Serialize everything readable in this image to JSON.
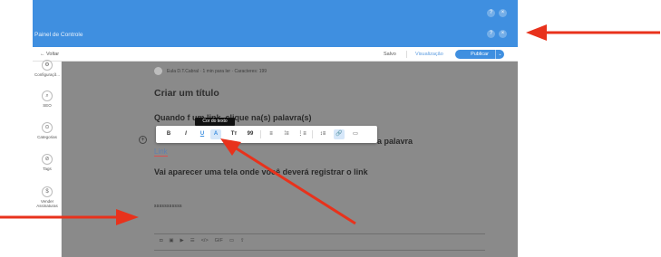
{
  "header": {
    "title": "Painel de Controle",
    "help_glyph": "?",
    "close_glyph": "×"
  },
  "subbar": {
    "back_label": "← Voltar",
    "saved_label": "Salvo",
    "preview_label": "Visualização",
    "publish_label": "Publicar",
    "publish_dropdown_glyph": "⌄"
  },
  "sidebar": {
    "items": [
      {
        "label": "Configuraçõ...",
        "icon": "gear-icon",
        "glyph": "⚙"
      },
      {
        "label": "SEO",
        "icon": "search-icon",
        "glyph": "⌕"
      },
      {
        "label": "Categorias",
        "icon": "category-icon",
        "glyph": "⊙"
      },
      {
        "label": "Tags",
        "icon": "tag-icon",
        "glyph": "⊘"
      },
      {
        "label": "Vender Assinaturas",
        "icon": "dollar-icon",
        "glyph": "$"
      }
    ]
  },
  "post": {
    "author_line": "Eula D.T.Cabral · 1 min para ler · Caracteres: 199",
    "title": "Criar um título",
    "paragraph1": "Quando f          um link, clique na(s) palavra(s)",
    "paragraph2_end": "a palavra",
    "link_word": "Link",
    "paragraph3": "Vai aparecer uma tela onde você deverá registrar o link",
    "placeholder": "sssssssssss",
    "plus_glyph": "+"
  },
  "format_toolbar": {
    "tooltip": "Cor do texto",
    "buttons": [
      {
        "name": "bold-button",
        "glyph": "B"
      },
      {
        "name": "italic-button",
        "glyph": "I"
      },
      {
        "name": "underline-button",
        "glyph": "U"
      },
      {
        "name": "text-color-button",
        "glyph": "A"
      },
      {
        "name": "text-size-button",
        "glyph": "Tт"
      },
      {
        "name": "quote-button",
        "glyph": "99"
      },
      {
        "name": "align-left-button",
        "glyph": "≡"
      },
      {
        "name": "numbered-list-button",
        "glyph": "⁞≡"
      },
      {
        "name": "bullet-list-button",
        "glyph": "⋮≡"
      },
      {
        "name": "line-spacing-button",
        "glyph": "↕≡"
      },
      {
        "name": "link-button",
        "glyph": "🔗"
      },
      {
        "name": "embed-button",
        "glyph": "▭"
      }
    ]
  },
  "insert_bar": {
    "items": [
      {
        "name": "camera-icon",
        "glyph": "◘"
      },
      {
        "name": "gallery-icon",
        "glyph": "▣"
      },
      {
        "name": "video-icon",
        "glyph": "▶"
      },
      {
        "name": "divider-icon",
        "glyph": "☰"
      },
      {
        "name": "code-icon",
        "glyph": "</>"
      },
      {
        "name": "gif-icon",
        "glyph": "GIF"
      },
      {
        "name": "embed-icon",
        "glyph": "▭"
      },
      {
        "name": "upload-icon",
        "glyph": "⇪"
      }
    ]
  },
  "colors": {
    "brand_blue": "#3f8fe0",
    "overlay_gray": "#8a8a8a",
    "annotation_red": "#e8321c"
  }
}
